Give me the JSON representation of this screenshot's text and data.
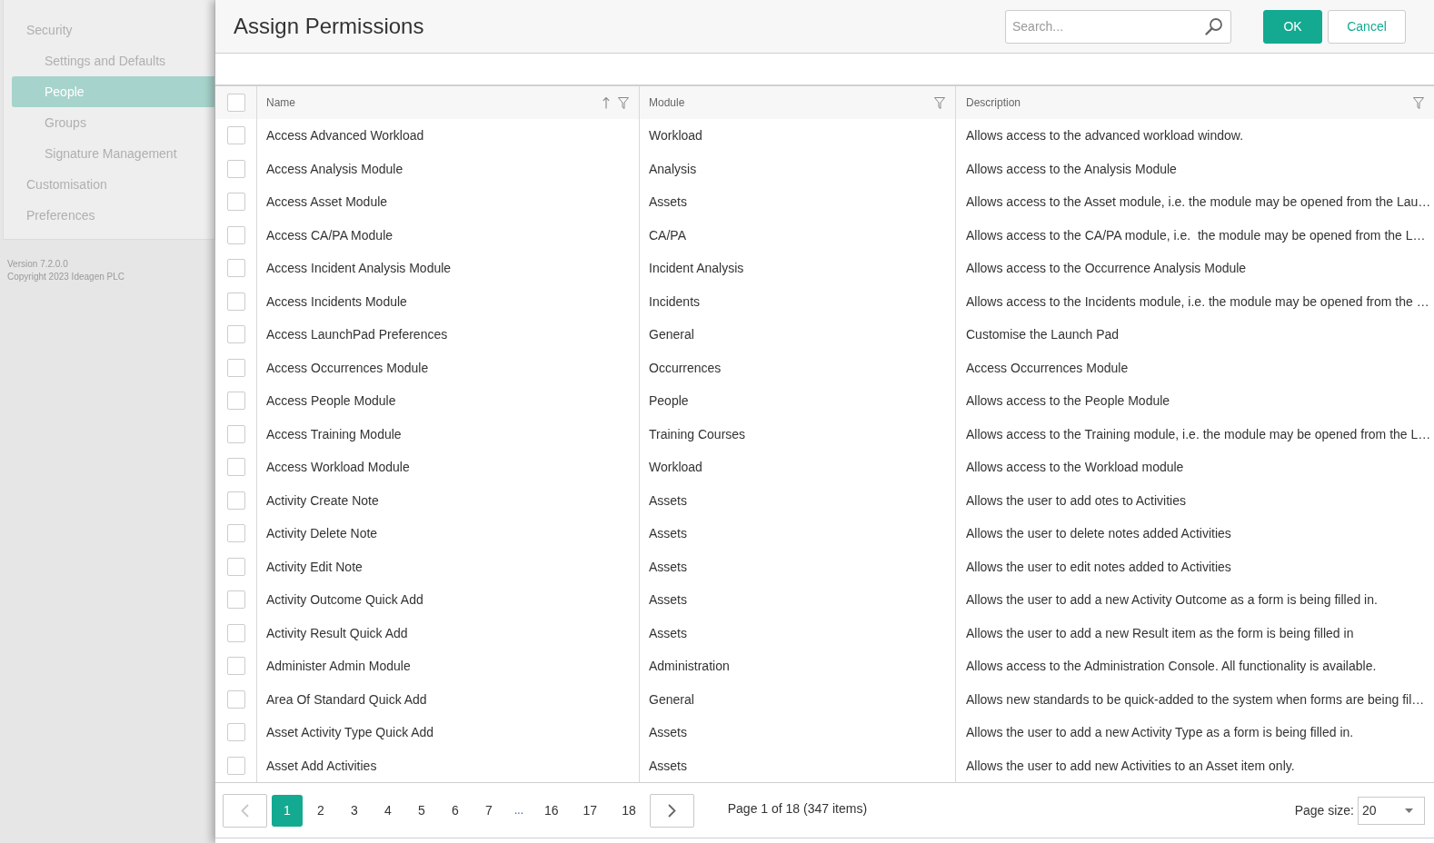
{
  "sidebar": {
    "items": [
      {
        "label": "Security",
        "selected": false,
        "children": [
          {
            "label": "Settings and Defaults",
            "selected": false
          },
          {
            "label": "People",
            "selected": true
          },
          {
            "label": "Groups",
            "selected": false
          },
          {
            "label": "Signature Management",
            "selected": false
          }
        ]
      },
      {
        "label": "Customisation",
        "selected": false
      },
      {
        "label": "Preferences",
        "selected": false
      }
    ],
    "version": "Version 7.2.0.0",
    "copyright": "Copyright 2023 Ideagen PLC"
  },
  "dialog": {
    "title": "Assign Permissions",
    "search": {
      "placeholder": "Search..."
    },
    "buttons": [
      {
        "label": "OK",
        "kind": "primary"
      },
      {
        "label": "Cancel",
        "kind": "secondary"
      }
    ]
  },
  "table": {
    "select_all": {
      "checked": false
    },
    "columns": [
      {
        "label": "Name",
        "sorted": true,
        "filter": true
      },
      {
        "label": "Module",
        "sorted": false,
        "filter": true
      },
      {
        "label": "Description",
        "sorted": false,
        "filter": true
      }
    ],
    "rows": [
      {
        "checked": false,
        "cells": [
          "Access Advanced Workload",
          "Workload",
          "Allows access to the advanced workload window."
        ]
      },
      {
        "checked": false,
        "cells": [
          "Access Analysis Module",
          "Analysis",
          "Allows access to the Analysis Module"
        ]
      },
      {
        "checked": false,
        "cells": [
          "Access Asset Module",
          "Assets",
          "Allows access to the Asset module, i.e. the module may be opened from the Lau…"
        ]
      },
      {
        "checked": false,
        "cells": [
          "Access CA/PA Module",
          "CA/PA",
          "Allows access to the CA/PA module, i.e.  the module may be opened from the L…"
        ]
      },
      {
        "checked": false,
        "cells": [
          "Access Incident Analysis Module",
          "Incident Analysis",
          "Allows access to the Occurrence Analysis Module"
        ]
      },
      {
        "checked": false,
        "cells": [
          "Access Incidents Module",
          "Incidents",
          "Allows access to the Incidents module, i.e. the module may be opened from the …"
        ]
      },
      {
        "checked": false,
        "cells": [
          "Access LaunchPad Preferences",
          "General",
          "Customise the Launch Pad"
        ]
      },
      {
        "checked": false,
        "cells": [
          "Access Occurrences Module",
          "Occurrences",
          "Access Occurrences Module"
        ]
      },
      {
        "checked": false,
        "cells": [
          "Access People Module",
          "People",
          "Allows access to the People Module"
        ]
      },
      {
        "checked": false,
        "cells": [
          "Access Training Module",
          "Training Courses",
          "Allows access to the Training module, i.e. the module may be opened from the L…"
        ]
      },
      {
        "checked": false,
        "cells": [
          "Access Workload Module",
          "Workload",
          "Allows access to the Workload module"
        ]
      },
      {
        "checked": false,
        "cells": [
          "Activity Create Note",
          "Assets",
          "Allows the user to add otes to Activities"
        ]
      },
      {
        "checked": false,
        "cells": [
          "Activity Delete Note",
          "Assets",
          "Allows the user to delete notes added Activities"
        ]
      },
      {
        "checked": false,
        "cells": [
          "Activity Edit Note",
          "Assets",
          "Allows the user to edit notes added to Activities"
        ]
      },
      {
        "checked": false,
        "cells": [
          "Activity Outcome Quick Add",
          "Assets",
          "Allows the user to add a new Activity Outcome as a form is being filled in."
        ]
      },
      {
        "checked": false,
        "cells": [
          "Activity Result Quick Add",
          "Assets",
          "Allows the user to add a new Result item as the form is being filled in"
        ]
      },
      {
        "checked": false,
        "cells": [
          "Administer Admin Module",
          "Administration",
          "Allows access to the Administration Console. All functionality is available."
        ]
      },
      {
        "checked": false,
        "cells": [
          "Area Of Standard Quick Add",
          "General",
          "Allows new standards to be quick-added to the system when forms are being fil…"
        ]
      },
      {
        "checked": false,
        "cells": [
          "Asset Activity Type Quick Add",
          "Assets",
          "Allows the user to add a new Activity Type as a form is being filled in."
        ]
      },
      {
        "checked": false,
        "cells": [
          "Asset Add Activities",
          "Assets",
          "Allows the user to add new Activities to an Asset item only."
        ]
      }
    ]
  },
  "pagination": {
    "prev": {
      "disabled": true
    },
    "pages": [
      {
        "label": "1",
        "kind": "page",
        "selected": true
      },
      {
        "label": "2",
        "kind": "page",
        "selected": false
      },
      {
        "label": "3",
        "kind": "page",
        "selected": false
      },
      {
        "label": "4",
        "kind": "page",
        "selected": false
      },
      {
        "label": "5",
        "kind": "page",
        "selected": false
      },
      {
        "label": "6",
        "kind": "page",
        "selected": false
      },
      {
        "label": "7",
        "kind": "page",
        "selected": false
      },
      {
        "label": "...",
        "kind": "ellipsis",
        "selected": false
      },
      {
        "label": "16",
        "kind": "page",
        "selected": false
      },
      {
        "label": "17",
        "kind": "page",
        "selected": false
      },
      {
        "label": "18",
        "kind": "page",
        "selected": false
      }
    ],
    "next": {
      "disabled": false
    },
    "summary": "Page 1 of 18 (347 items)",
    "page_size": {
      "label": "Page size:",
      "value": "20"
    }
  }
}
